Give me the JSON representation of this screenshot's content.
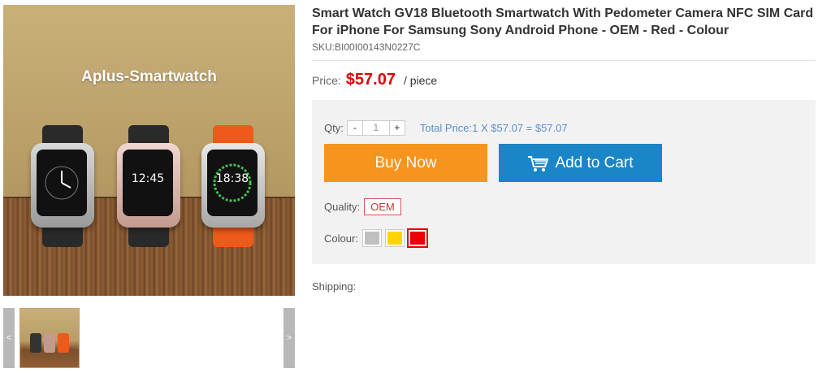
{
  "gallery": {
    "brand_text": "Aplus-Smartwatch",
    "watch_times": [
      "12:45",
      "18:38"
    ],
    "prev_label": "<",
    "next_label": ">"
  },
  "product": {
    "title": "Smart Watch GV18 Bluetooth Smartwatch With Pedometer Camera NFC SIM Card For iPhone For Samsung Sony Android Phone - OEM - Red - Colour",
    "sku": "SKU:BI00I00143N0227C",
    "price_label": "Price:",
    "price": "$57.07",
    "unit": "/ piece"
  },
  "purchase": {
    "qty_label": "Qty:",
    "minus": "-",
    "qty_value": "1",
    "plus": "+",
    "total_price": "Total Price:1 X $57.07 = $57.07",
    "buy_now": "Buy Now",
    "add_to_cart": "Add to Cart",
    "quality_label": "Quality:",
    "quality_option": "OEM",
    "colour_label": "Colour:",
    "colours": [
      "#c0c0c0",
      "#ffd400",
      "#ee0000"
    ],
    "selected_colour": "#ee0000"
  },
  "shipping_label": "Shipping:",
  "colors": {
    "price": "#e10000",
    "buy_button": "#f7941d",
    "cart_button": "#1a86c8",
    "total_text": "#5b8fc9"
  }
}
